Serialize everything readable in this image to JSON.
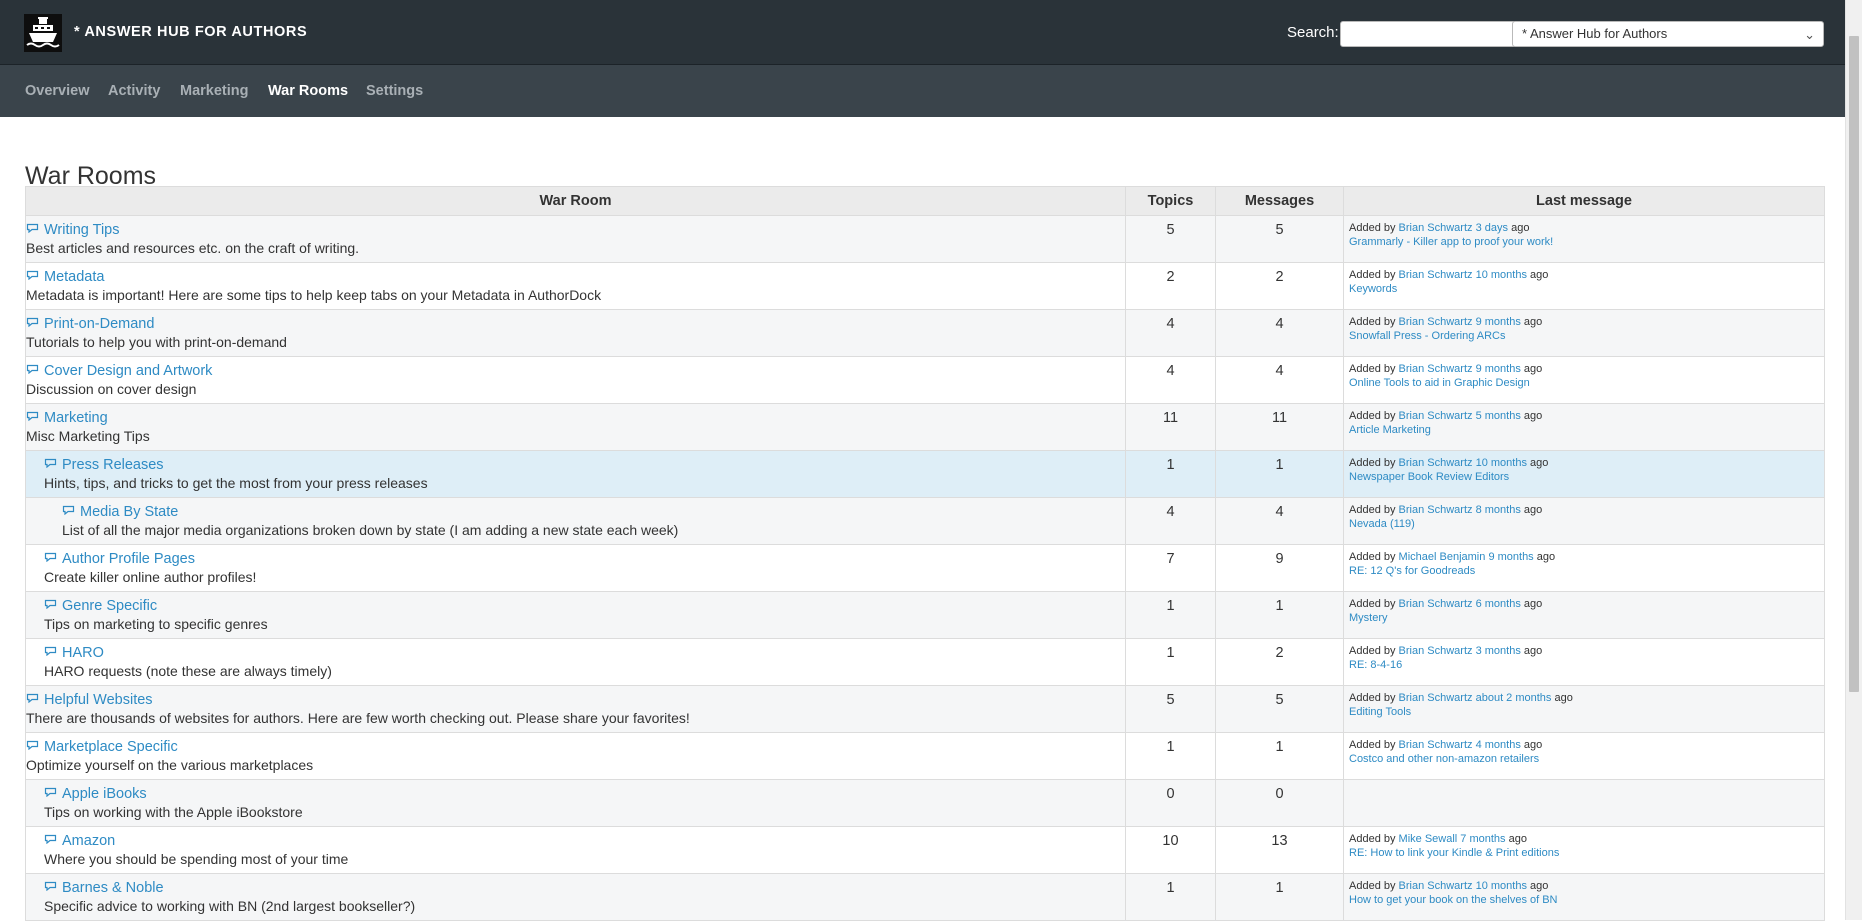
{
  "header": {
    "app_title": "* ANSWER HUB FOR AUTHORS",
    "search_label": "Search:",
    "search_value": "",
    "scope_selected": "* Answer Hub for Authors",
    "logo_icon": "ship-icon"
  },
  "nav": {
    "items": [
      "Overview",
      "Activity",
      "Marketing",
      "War Rooms",
      "Settings"
    ],
    "active": "War Rooms"
  },
  "page": {
    "title": "War Rooms"
  },
  "table": {
    "headers": {
      "room": "War Room",
      "topics": "Topics",
      "messages": "Messages",
      "last": "Last message"
    },
    "rows": [
      {
        "name": "Writing Tips",
        "desc": "Best articles and resources etc. on the craft of writing.",
        "topics": "5",
        "messages": "5",
        "added_by": "Added by",
        "author": "Brian Schwartz",
        "when": "3 days",
        "ago": "ago",
        "title": "Grammarly - Killer app to proof your work!"
      },
      {
        "name": "Metadata",
        "desc": "Metadata is important! Here are some tips to help keep tabs on your Metadata in AuthorDock",
        "topics": "2",
        "messages": "2",
        "added_by": "Added by",
        "author": "Brian Schwartz",
        "when": "10 months",
        "ago": "ago",
        "title": "Keywords"
      },
      {
        "name": "Print-on-Demand",
        "desc": "Tutorials to help you with print-on-demand",
        "topics": "4",
        "messages": "4",
        "added_by": "Added by",
        "author": "Brian Schwartz",
        "when": "9 months",
        "ago": "ago",
        "title": "Snowfall Press - Ordering ARCs"
      },
      {
        "name": "Cover Design and Artwork",
        "desc": "Discussion on cover design",
        "topics": "4",
        "messages": "4",
        "added_by": "Added by",
        "author": "Brian Schwartz",
        "when": "9 months",
        "ago": "ago",
        "title": "Online Tools to aid in Graphic Design"
      },
      {
        "name": "Marketing",
        "desc": "Misc Marketing Tips",
        "topics": "11",
        "messages": "11",
        "added_by": "Added by",
        "author": "Brian Schwartz",
        "when": "5 months",
        "ago": "ago",
        "title": "Article Marketing"
      },
      {
        "name": "Press Releases",
        "desc": "Hints, tips, and tricks to get the most from your press releases",
        "topics": "1",
        "messages": "1",
        "added_by": "Added by",
        "author": "Brian Schwartz",
        "when": "10 months",
        "ago": "ago",
        "title": "Newspaper Book Review Editors"
      },
      {
        "name": "Media By State",
        "desc": "List of all the major media organizations broken down by state (I am adding a new state each week)",
        "topics": "4",
        "messages": "4",
        "added_by": "Added by",
        "author": "Brian Schwartz",
        "when": "8 months",
        "ago": "ago",
        "title": "Nevada (119)"
      },
      {
        "name": "Author Profile Pages",
        "desc": "Create killer online author profiles!",
        "topics": "7",
        "messages": "9",
        "added_by": "Added by",
        "author": "Michael Benjamin",
        "when": "9 months",
        "ago": "ago",
        "title": "RE: 12 Q's for Goodreads"
      },
      {
        "name": "Genre Specific",
        "desc": "Tips on marketing to specific genres",
        "topics": "1",
        "messages": "1",
        "added_by": "Added by",
        "author": "Brian Schwartz",
        "when": "6 months",
        "ago": "ago",
        "title": "Mystery"
      },
      {
        "name": "HARO",
        "desc": "HARO requests (note these are always timely)",
        "topics": "1",
        "messages": "2",
        "added_by": "Added by",
        "author": "Brian Schwartz",
        "when": "3 months",
        "ago": "ago",
        "title": "RE: 8-4-16"
      },
      {
        "name": "Helpful Websites",
        "desc": "There are thousands of websites for authors. Here are few worth checking out. Please share your favorites!",
        "topics": "5",
        "messages": "5",
        "added_by": "Added by",
        "author": "Brian Schwartz",
        "when": "about 2 months",
        "ago": "ago",
        "title": "Editing Tools"
      },
      {
        "name": "Marketplace Specific",
        "desc": "Optimize yourself on the various marketplaces",
        "topics": "1",
        "messages": "1",
        "added_by": "Added by",
        "author": "Brian Schwartz",
        "when": "4 months",
        "ago": "ago",
        "title": "Costco and other non-amazon retailers"
      },
      {
        "name": "Apple iBooks",
        "desc": "Tips on working with the Apple iBookstore",
        "topics": "0",
        "messages": "0",
        "added_by": "",
        "author": "",
        "when": "",
        "ago": "",
        "title": ""
      },
      {
        "name": "Amazon",
        "desc": "Where you should be spending most of your time",
        "topics": "10",
        "messages": "13",
        "added_by": "Added by",
        "author": "Mike Sewall",
        "when": "7 months",
        "ago": "ago",
        "title": "RE: How to link your Kindle & Print editions"
      },
      {
        "name": "Barnes & Noble",
        "desc": "Specific advice to working with BN (2nd largest bookseller?)",
        "topics": "1",
        "messages": "1",
        "added_by": "Added by",
        "author": "Brian Schwartz",
        "when": "10 months",
        "ago": "ago",
        "title": "How to get your book on the shelves of BN"
      }
    ]
  },
  "colors": {
    "link": "#2e8bc4",
    "topbar": "#2a3339",
    "navbar": "#3a444b",
    "row_highlight": "#deeef7"
  }
}
